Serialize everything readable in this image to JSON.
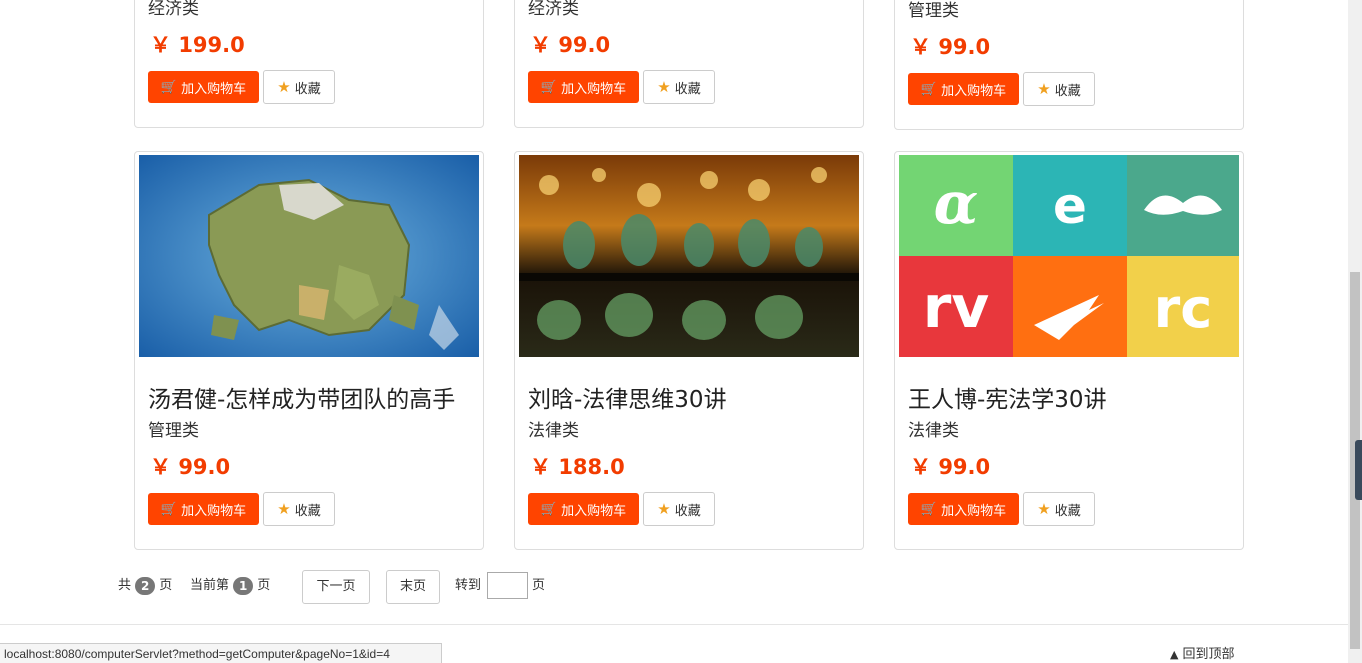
{
  "cart_label": "加入购物车",
  "fav_label": "收藏",
  "currency": "￥",
  "top_row": [
    {
      "category": "经济类",
      "price": "199.0"
    },
    {
      "category": "经济类",
      "price": "99.0"
    },
    {
      "category": "管理类",
      "price": "99.0"
    }
  ],
  "bottom_row": [
    {
      "title": "汤君健-怎样成为带团队的高手",
      "category": "管理类",
      "price": "99.0",
      "image": "fantasy-map"
    },
    {
      "title": "刘晗-法律思维30讲",
      "category": "法律类",
      "price": "188.0",
      "image": "glass-bottles"
    },
    {
      "title": "王人博-宪法学30讲",
      "category": "法律类",
      "price": "99.0",
      "image": "app-logos-grid"
    }
  ],
  "pager": {
    "total_prefix": "共",
    "total_pages": "2",
    "total_suffix": "页",
    "current_prefix": "当前第",
    "current_page": "1",
    "current_suffix": "页",
    "next_label": "下一页",
    "last_label": "末页",
    "goto_prefix": "转到",
    "goto_suffix": "页",
    "goto_value": ""
  },
  "status_url": "localhost:8080/computerServlet?method=getComputer&pageNo=1&id=4",
  "back_to_top": "回到顶部",
  "colors": {
    "accent": "#ff4400",
    "price": "#f23c00",
    "star": "#f0a020"
  }
}
